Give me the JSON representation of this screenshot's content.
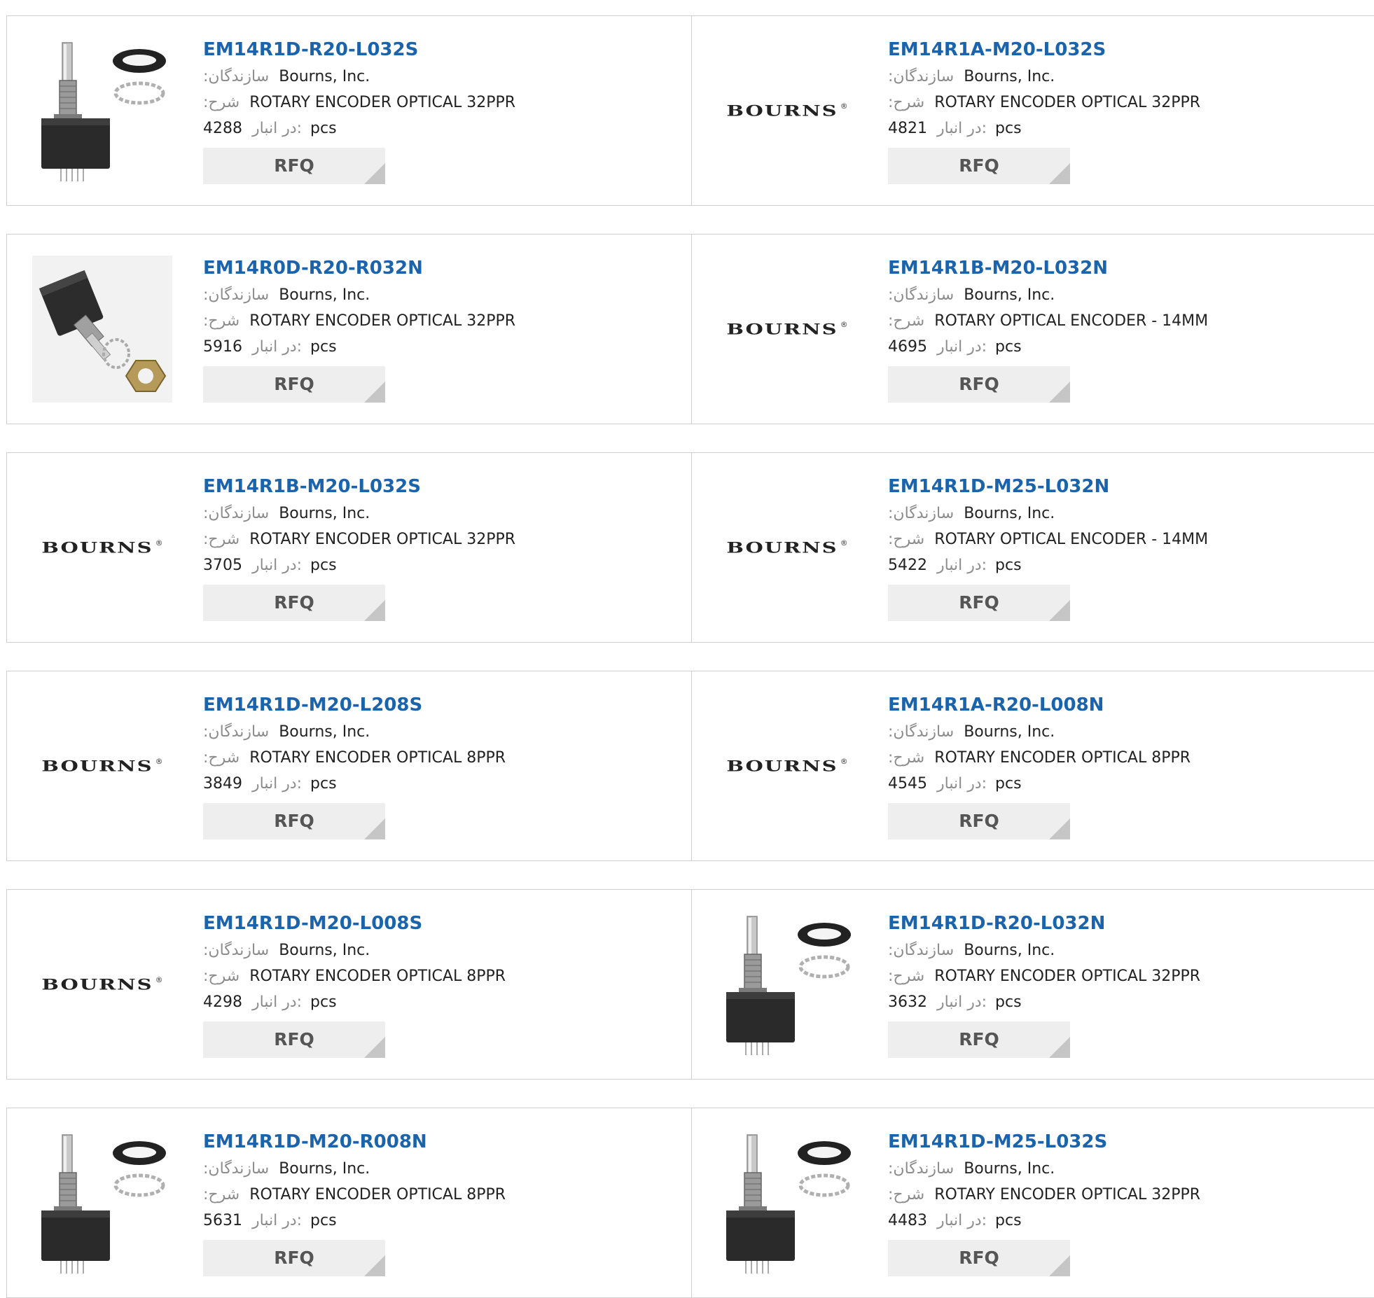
{
  "labels": {
    "manufacturer": ":سازندگان",
    "description": ":شرح",
    "stock": "در انبار:",
    "unit": "pcs",
    "rfq": "RFQ",
    "brand_logo": "BOURNS",
    "brand_reg": "®"
  },
  "products": [
    {
      "part": "EM14R1D-R20-L032S",
      "manufacturer": "Bourns, Inc.",
      "description": "ROTARY ENCODER OPTICAL 32PPR",
      "stock": "4288",
      "image": "encoder-photo"
    },
    {
      "part": "EM14R1A-M20-L032S",
      "manufacturer": "Bourns, Inc.",
      "description": "ROTARY ENCODER OPTICAL 32PPR",
      "stock": "4821",
      "image": "bourns-logo"
    },
    {
      "part": "EM14R0D-R20-R032N",
      "manufacturer": "Bourns, Inc.",
      "description": "ROTARY ENCODER OPTICAL 32PPR",
      "stock": "5916",
      "image": "encoder-angled-photo"
    },
    {
      "part": "EM14R1B-M20-L032N",
      "manufacturer": "Bourns, Inc.",
      "description": "ROTARY OPTICAL ENCODER - 14MM",
      "stock": "4695",
      "image": "bourns-logo"
    },
    {
      "part": "EM14R1B-M20-L032S",
      "manufacturer": "Bourns, Inc.",
      "description": "ROTARY ENCODER OPTICAL 32PPR",
      "stock": "3705",
      "image": "bourns-logo"
    },
    {
      "part": "EM14R1D-M25-L032N",
      "manufacturer": "Bourns, Inc.",
      "description": "ROTARY OPTICAL ENCODER - 14MM",
      "stock": "5422",
      "image": "bourns-logo"
    },
    {
      "part": "EM14R1D-M20-L208S",
      "manufacturer": "Bourns, Inc.",
      "description": "ROTARY ENCODER OPTICAL 8PPR",
      "stock": "3849",
      "image": "bourns-logo"
    },
    {
      "part": "EM14R1A-R20-L008N",
      "manufacturer": "Bourns, Inc.",
      "description": "ROTARY ENCODER OPTICAL 8PPR",
      "stock": "4545",
      "image": "bourns-logo"
    },
    {
      "part": "EM14R1D-M20-L008S",
      "manufacturer": "Bourns, Inc.",
      "description": "ROTARY ENCODER OPTICAL 8PPR",
      "stock": "4298",
      "image": "bourns-logo"
    },
    {
      "part": "EM14R1D-R20-L032N",
      "manufacturer": "Bourns, Inc.",
      "description": "ROTARY ENCODER OPTICAL 32PPR",
      "stock": "3632",
      "image": "encoder-photo"
    },
    {
      "part": "EM14R1D-M20-R008N",
      "manufacturer": "Bourns, Inc.",
      "description": "ROTARY ENCODER OPTICAL 8PPR",
      "stock": "5631",
      "image": "encoder-photo"
    },
    {
      "part": "EM14R1D-M25-L032S",
      "manufacturer": "Bourns, Inc.",
      "description": "ROTARY ENCODER OPTICAL 32PPR",
      "stock": "4483",
      "image": "encoder-photo"
    }
  ]
}
